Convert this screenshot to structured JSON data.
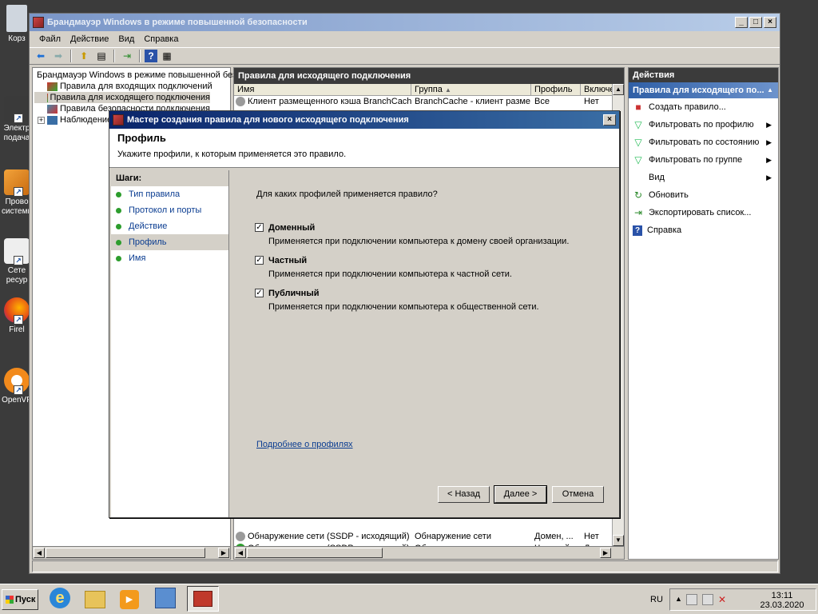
{
  "desktop": {
    "icons": [
      {
        "label": "Корз"
      },
      {
        "label": "Электр\nподача"
      },
      {
        "label": "Прово\nсистемн"
      },
      {
        "label": "Сете\nресур"
      },
      {
        "label": "Firel"
      },
      {
        "label": "OpenVP"
      }
    ]
  },
  "window": {
    "title": "Брандмауэр Windows в режиме повышенной безопасности",
    "menu": [
      "Файл",
      "Действие",
      "Вид",
      "Справка"
    ]
  },
  "tree": {
    "root": "Брандмауэр Windows в режиме повышенной безоп",
    "items": [
      {
        "label": "Правила для входящих подключений"
      },
      {
        "label": "Правила для исходящего подключения"
      },
      {
        "label": "Правила безопасности подключения"
      },
      {
        "label": "Наблюдение"
      }
    ]
  },
  "rules": {
    "title": "Правила для исходящего подключения",
    "columns": [
      "Имя",
      "Группа",
      "Профиль",
      "Включе"
    ],
    "top_row": {
      "name": "Клиент размещенного кэша BranchCache (...",
      "group": "BranchCache - клиент разме...",
      "profile": "Все",
      "enabled": "Нет"
    },
    "bottom_rows": [
      {
        "name": "Обнаружение сети (SSDP - исходящий)",
        "group": "Обнаружение сети",
        "profile": "Домен, ...",
        "enabled": "Нет"
      },
      {
        "name": "Обнаружение сети (SSDP - исходящий)",
        "group": "Обнаружение сети",
        "profile": "Частный",
        "enabled": "Да"
      }
    ]
  },
  "actions": {
    "header": "Действия",
    "section": "Правила для исходящего по...",
    "items": [
      {
        "label": "Создать правило...",
        "icon": "new-rule-icon"
      },
      {
        "label": "Фильтровать по профилю",
        "icon": "filter-icon",
        "submenu": true
      },
      {
        "label": "Фильтровать по состоянию",
        "icon": "filter-icon",
        "submenu": true
      },
      {
        "label": "Фильтровать по группе",
        "icon": "filter-icon",
        "submenu": true
      },
      {
        "label": "Вид",
        "icon": "",
        "submenu": true
      },
      {
        "label": "Обновить",
        "icon": "refresh-icon"
      },
      {
        "label": "Экспортировать список...",
        "icon": "export-icon"
      },
      {
        "label": "Справка",
        "icon": "help-icon"
      }
    ]
  },
  "wizard": {
    "title": "Мастер создания правила для нового исходящего подключения",
    "heading": "Профиль",
    "subheading": "Укажите профили, к которым применяется это правило.",
    "steps_title": "Шаги:",
    "steps": [
      "Тип правила",
      "Протокол и порты",
      "Действие",
      "Профиль",
      "Имя"
    ],
    "question": "Для каких профилей применяется правило?",
    "profiles": [
      {
        "label": "Доменный",
        "desc": "Применяется при подключении компьютера к домену своей организации.",
        "checked": true
      },
      {
        "label": "Частный",
        "desc": "Применяется при подключении компьютера к частной сети.",
        "checked": true
      },
      {
        "label": "Публичный",
        "desc": "Применяется при подключении компьютера к общественной сети.",
        "checked": true
      }
    ],
    "link": "Подробнее о профилях",
    "buttons": {
      "back": "< Назад",
      "next": "Далее >",
      "cancel": "Отмена"
    }
  },
  "taskbar": {
    "start": "Пуск",
    "lang": "RU",
    "time": "13:11",
    "date": "23.03.2020"
  }
}
